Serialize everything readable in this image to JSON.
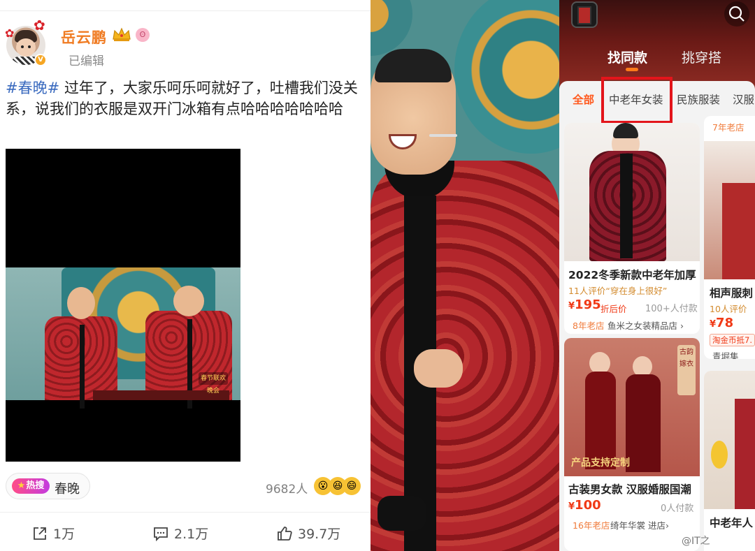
{
  "weibo": {
    "username": "岳云鹏",
    "edited_label": "已编辑",
    "verified_mark": "V",
    "post": {
      "hashtag": "#春晚#",
      "text": " 过年了，大家乐呵乐呵就好了，吐槽我们没关系，说我们的衣服是双开门冰箱有点哈哈哈哈哈哈哈"
    },
    "video_logo": "春节联欢晚会",
    "hot": {
      "badge": "热搜",
      "topic": "春晚"
    },
    "viewers": "9682人",
    "actions": {
      "share": "1万",
      "comment": "2.1万",
      "like": "39.7万"
    }
  },
  "shop": {
    "tabs": [
      "找同款",
      "挑穿搭"
    ],
    "categories": [
      "全部",
      "中老年女装",
      "民族服装",
      "汉服"
    ],
    "card1": {
      "title": "2022冬季新款中老年加厚",
      "review": "11人评价“穿在身上很好”",
      "currency": "¥",
      "price": "195",
      "price_label": "折后价",
      "buyers": "100+人付款",
      "shop_age": "8年老店",
      "shop_name": "鱼米之女装精品店",
      "chevron": "›"
    },
    "card2": {
      "title": "古装男女款 汉服婚服国潮",
      "overlay": "产品支持定制",
      "seal": "古韵嫁衣",
      "currency": "¥",
      "price": "100",
      "buyers": "0人付款",
      "shop_age": "16年老店",
      "shop_name": "绮年华裳",
      "enter": "进店",
      "chevron": "›"
    },
    "side1": {
      "shop_age": "7年老店",
      "title": "相声服刺",
      "review": "10人评价",
      "currency": "¥",
      "price": "78",
      "tb_tag": "淘金币抵7.",
      "shop_name": "青堀集"
    },
    "side2": {
      "title": "中老年人"
    },
    "watermark": "@IT之"
  },
  "colors": {
    "weibo_orange": "#f07c23",
    "hashtag_blue": "#3b6bbf",
    "price_red": "#f03a17",
    "highlight_box": "#e3151b"
  }
}
